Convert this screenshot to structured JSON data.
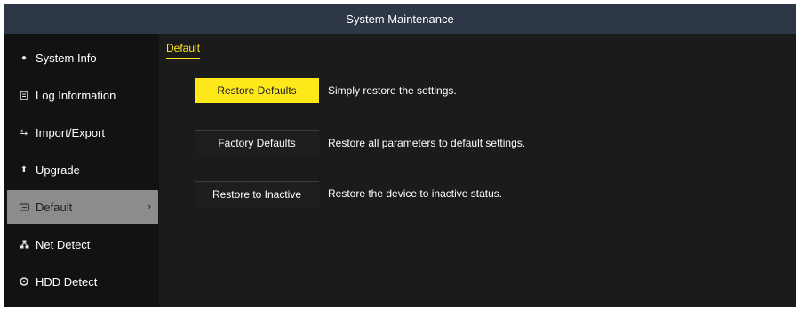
{
  "window": {
    "title": "System Maintenance"
  },
  "sidebar": {
    "items": [
      {
        "label": "System Info",
        "icon": "info-icon"
      },
      {
        "label": "Log Information",
        "icon": "log-icon"
      },
      {
        "label": "Import/Export",
        "icon": "import-export-icon"
      },
      {
        "label": "Upgrade",
        "icon": "upgrade-arrow-icon"
      },
      {
        "label": "Default",
        "icon": "default-icon",
        "active": true
      },
      {
        "label": "Net Detect",
        "icon": "network-icon"
      },
      {
        "label": "HDD Detect",
        "icon": "hdd-icon"
      }
    ]
  },
  "main": {
    "tab": "Default",
    "actions": [
      {
        "button": "Restore Defaults",
        "description": "Simply restore the settings.",
        "highlighted": true
      },
      {
        "button": "Factory Defaults",
        "description": "Restore all parameters to default settings."
      },
      {
        "button": "Restore to Inactive",
        "description": "Restore the device to inactive status."
      }
    ]
  },
  "colors": {
    "accent": "#ffe81a",
    "titlebar": "#2e3747",
    "background": "#1b1b1b",
    "sidebar": "#121212",
    "active_item": "#8c8c8c"
  }
}
